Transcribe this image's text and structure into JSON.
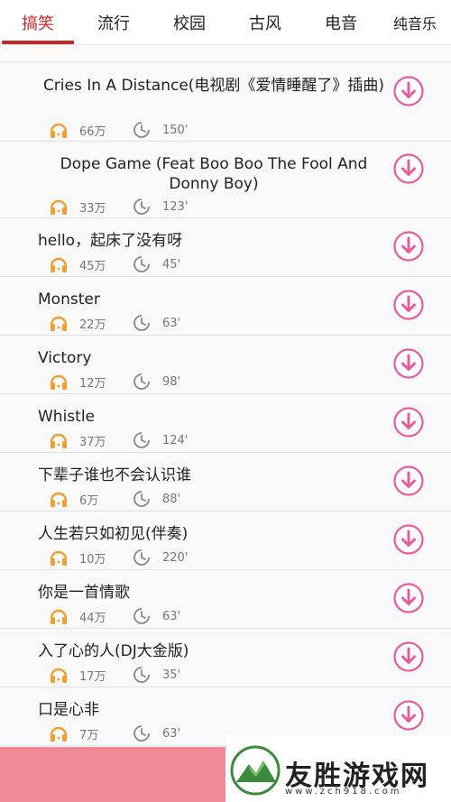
{
  "tabs": [
    {
      "label": "搞笑",
      "active": true
    },
    {
      "label": "流行",
      "active": false
    },
    {
      "label": "校园",
      "active": false
    },
    {
      "label": "古风",
      "active": false
    },
    {
      "label": "电音",
      "active": false
    },
    {
      "label": "纯音乐",
      "active": false
    }
  ],
  "songs": [
    {
      "title": "Cries In A Distance(电视剧《爱情睡醒了》插曲)",
      "plays": "66万",
      "duration": "150'"
    },
    {
      "title": "Dope Game (Feat Boo Boo The Fool And Donny Boy)",
      "plays": "33万",
      "duration": "123'"
    },
    {
      "title": "hello，起床了没有呀",
      "plays": "45万",
      "duration": "45'"
    },
    {
      "title": "Monster",
      "plays": "22万",
      "duration": "63'"
    },
    {
      "title": "Victory",
      "plays": "12万",
      "duration": "98'"
    },
    {
      "title": "Whistle",
      "plays": "37万",
      "duration": "124'"
    },
    {
      "title": "下辈子谁也不会认识谁",
      "plays": "6万",
      "duration": "88'"
    },
    {
      "title": "人生若只如初见(伴奏)",
      "plays": "10万",
      "duration": "220'"
    },
    {
      "title": "你是一首情歌",
      "plays": "44万",
      "duration": "63'"
    },
    {
      "title": "入了心的人(DJ大金版)",
      "plays": "17万",
      "duration": "35'"
    },
    {
      "title": "口是心非",
      "plays": "7万",
      "duration": "63'"
    }
  ],
  "icons": {
    "plays": "headphones-icon",
    "duration": "clock-icon",
    "download": "download-icon"
  },
  "colors": {
    "accent": "#c62828",
    "download": "#e75c9c",
    "headphones": "#f0a030",
    "footer": "#f18a97"
  },
  "watermark": {
    "text": "友胜游戏网",
    "url": "www.zch918.com"
  }
}
